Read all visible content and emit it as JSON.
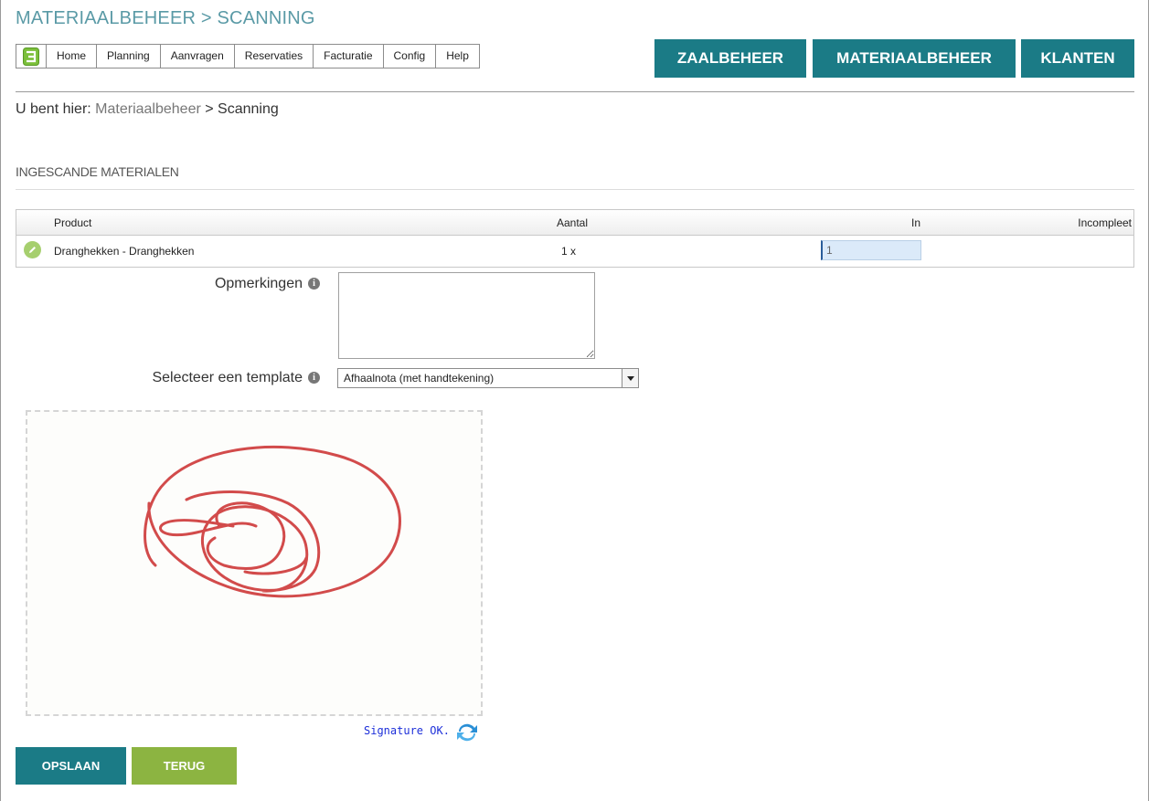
{
  "page": {
    "title": "MATERIAALBEHEER > SCANNING"
  },
  "nav": {
    "items": [
      "Home",
      "Planning",
      "Aanvragen",
      "Reservaties",
      "Facturatie",
      "Config",
      "Help"
    ]
  },
  "modules": {
    "zaalbeheer": "ZAALBEHEER",
    "materiaalbeheer": "MATERIAALBEHEER",
    "klanten": "KLANTEN"
  },
  "breadcrumb": {
    "prefix": "U bent hier:",
    "link": "Materiaalbeheer",
    "separator": ">",
    "current": "Scanning"
  },
  "section": {
    "title": "INGESCANDE MATERIALEN"
  },
  "table": {
    "headers": {
      "product": "Product",
      "aantal": "Aantal",
      "in": "In",
      "incompleet": "Incompleet"
    },
    "rows": [
      {
        "product": "Dranghekken - Dranghekken",
        "aantal": "1 x",
        "in": "1"
      }
    ]
  },
  "form": {
    "remarks_label": "Opmerkingen",
    "remarks_value": "",
    "template_label": "Selecteer een template",
    "template_selected": "Afhaalnota (met handtekening)"
  },
  "signature": {
    "status": "Signature OK."
  },
  "buttons": {
    "save": "OPSLAAN",
    "back": "TERUG"
  },
  "colors": {
    "teal": "#1b7b86",
    "green": "#8cb441",
    "heading": "#5a9aa6",
    "signature_ink": "#d24b4b"
  }
}
